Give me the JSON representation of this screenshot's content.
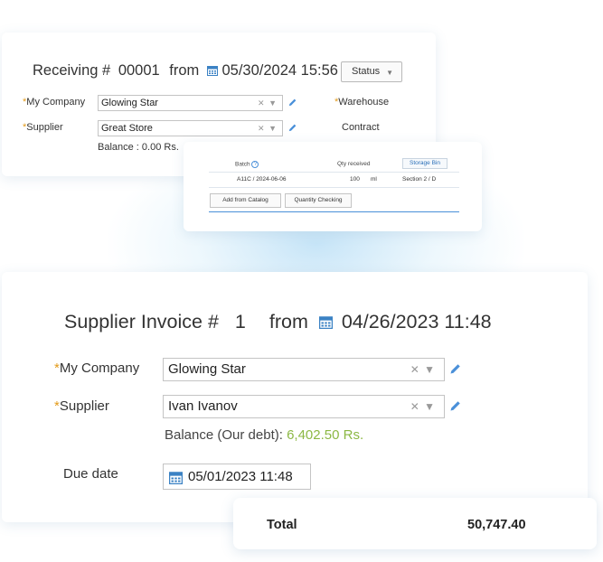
{
  "receiving": {
    "title_prefix": "Receiving #",
    "number": "00001",
    "from_label": "from",
    "datetime": "05/30/2024 15:56",
    "status_label": "Status",
    "my_company_label": "My Company",
    "my_company_value": "Glowing Star",
    "warehouse_label": "Warehouse",
    "supplier_label": "Supplier",
    "supplier_value": "Great Store",
    "contract_label": "Contract",
    "balance": "Balance : 0.00 Rs."
  },
  "batch_table": {
    "columns": [
      "Batch",
      "Qty received",
      "Storage Bin"
    ],
    "row": {
      "batch": "A11C / 2024-06-06",
      "qty": "100",
      "unit": "ml",
      "bin": "Section 2 / D"
    },
    "add_from_catalog": "Add from Catalog",
    "quantity_checking": "Quantity Checking"
  },
  "invoice": {
    "title_prefix": "Supplier Invoice #",
    "number": "1",
    "from_label": "from",
    "datetime": "04/26/2023 11:48",
    "my_company_label": "My Company",
    "my_company_value": "Glowing Star",
    "supplier_label": "Supplier",
    "supplier_value": "Ivan Ivanov",
    "balance_label": "Balance (Our debt):",
    "balance_amount": "6,402.50 Rs.",
    "due_date_label": "Due date",
    "due_date_value": "05/01/2023 11:48"
  },
  "total": {
    "label": "Total",
    "value": "50,747.40"
  },
  "colors": {
    "accent_blue": "#2a6fb8",
    "required_star": "#e39b1b",
    "debt_green": "#8cb844"
  },
  "icons": [
    "calendar-icon",
    "pencil-icon",
    "clear-icon",
    "chevron-down-icon",
    "help-icon"
  ]
}
